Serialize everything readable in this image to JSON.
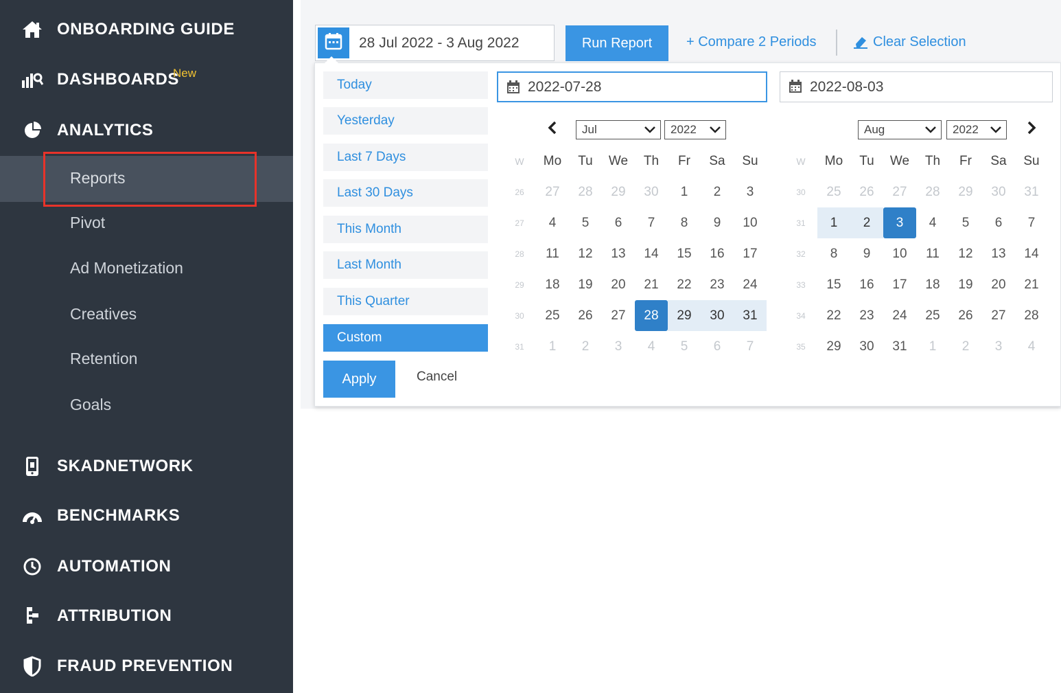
{
  "sidebar": {
    "main_items": [
      {
        "label": "ONBOARDING GUIDE",
        "icon": "home-icon"
      },
      {
        "label": "DASHBOARDS",
        "icon": "dashboard-icon",
        "badge": "New"
      },
      {
        "label": "ANALYTICS",
        "icon": "pie-chart-icon"
      },
      {
        "label": "SKADNETWORK",
        "icon": "device-icon"
      },
      {
        "label": "BENCHMARKS",
        "icon": "gauge-icon"
      },
      {
        "label": "AUTOMATION",
        "icon": "clock-icon"
      },
      {
        "label": "ATTRIBUTION",
        "icon": "attribution-icon"
      },
      {
        "label": "FRAUD PREVENTION",
        "icon": "shield-icon"
      }
    ],
    "sub_items": [
      "Reports",
      "Pivot",
      "Ad Monetization",
      "Creatives",
      "Retention",
      "Goals"
    ],
    "active_sub": "Reports"
  },
  "toolbar": {
    "date_range": "28 Jul 2022 - 3 Aug 2022",
    "run_report": "Run Report",
    "compare": "+ Compare 2 Periods",
    "clear": "Clear Selection"
  },
  "picker": {
    "presets": [
      "Today",
      "Yesterday",
      "Last 7 Days",
      "Last 30 Days",
      "This Month",
      "Last Month",
      "This Quarter",
      "Custom"
    ],
    "active_preset": "Custom",
    "apply": "Apply",
    "cancel": "Cancel",
    "start_date": "2022-07-28",
    "end_date": "2022-08-03",
    "weekday_header": [
      "W",
      "Mo",
      "Tu",
      "We",
      "Th",
      "Fr",
      "Sa",
      "Su"
    ],
    "left": {
      "month": "Jul",
      "year": "2022",
      "weeks": [
        {
          "w": "26",
          "days": [
            "27",
            "28",
            "29",
            "30",
            "1",
            "2",
            "3"
          ],
          "other": [
            0,
            1,
            2,
            3
          ]
        },
        {
          "w": "27",
          "days": [
            "4",
            "5",
            "6",
            "7",
            "8",
            "9",
            "10"
          ],
          "other": []
        },
        {
          "w": "28",
          "days": [
            "11",
            "12",
            "13",
            "14",
            "15",
            "16",
            "17"
          ],
          "other": []
        },
        {
          "w": "29",
          "days": [
            "18",
            "19",
            "20",
            "21",
            "22",
            "23",
            "24"
          ],
          "other": []
        },
        {
          "w": "30",
          "days": [
            "25",
            "26",
            "27",
            "28",
            "29",
            "30",
            "31"
          ],
          "other": [],
          "sel": [
            3
          ],
          "range": [
            4,
            5,
            6
          ]
        },
        {
          "w": "31",
          "days": [
            "1",
            "2",
            "3",
            "4",
            "5",
            "6",
            "7"
          ],
          "other": [
            0,
            1,
            2,
            3,
            4,
            5,
            6
          ]
        }
      ]
    },
    "right": {
      "month": "Aug",
      "year": "2022",
      "weeks": [
        {
          "w": "30",
          "days": [
            "25",
            "26",
            "27",
            "28",
            "29",
            "30",
            "31"
          ],
          "other": [
            0,
            1,
            2,
            3,
            4,
            5,
            6
          ]
        },
        {
          "w": "31",
          "days": [
            "1",
            "2",
            "3",
            "4",
            "5",
            "6",
            "7"
          ],
          "other": [],
          "range": [
            0,
            1
          ],
          "sel": [
            2
          ]
        },
        {
          "w": "32",
          "days": [
            "8",
            "9",
            "10",
            "11",
            "12",
            "13",
            "14"
          ],
          "other": []
        },
        {
          "w": "33",
          "days": [
            "15",
            "16",
            "17",
            "18",
            "19",
            "20",
            "21"
          ],
          "other": []
        },
        {
          "w": "34",
          "days": [
            "22",
            "23",
            "24",
            "25",
            "26",
            "27",
            "28"
          ],
          "other": []
        },
        {
          "w": "35",
          "days": [
            "29",
            "30",
            "31",
            "1",
            "2",
            "3",
            "4"
          ],
          "other": [
            3,
            4,
            5,
            6
          ]
        }
      ]
    }
  },
  "colors": {
    "sidebar_bg": "#2e3640",
    "accent": "#3a95e3",
    "highlight": "#e8332a"
  }
}
